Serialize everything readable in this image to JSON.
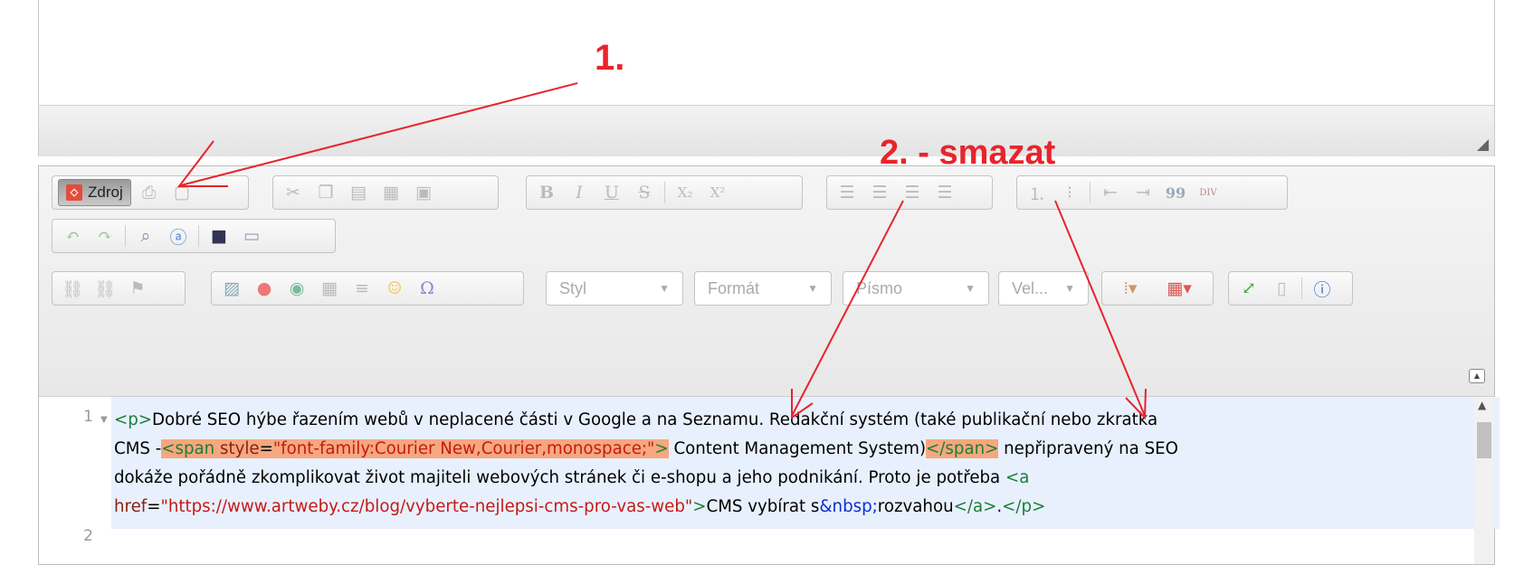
{
  "annotations": {
    "step1": "1.",
    "step2": "2. - smazat"
  },
  "toolbar": {
    "source_button": "Zdroj",
    "bold": "B",
    "italic": "I",
    "underline": "U",
    "strike": "S",
    "subscript": "X₂",
    "superscript": "X²",
    "blockquote": "99",
    "div": "DIV",
    "combos": {
      "style": "Styl",
      "format": "Formát",
      "font": "Písmo",
      "size": "Vel..."
    }
  },
  "code": {
    "line_numbers": [
      "1",
      "2"
    ],
    "line1": {
      "p_open": "<p>",
      "text1": "Dobré SEO hýbe řazením webů v neplacené části v Google a na Seznamu. Redakční systém (také publikační nebo zkratka",
      "text2_start": "CMS -",
      "span_open_start": "<span ",
      "span_attr": "style",
      "span_eq": "=",
      "span_val": "\"font-family:Courier New,Courier,monospace;\"",
      "span_open_end": ">",
      "text3": " Content Management System)",
      "span_close": "</span>",
      "text4": " nepřipravený na SEO",
      "text5": "dokáže pořádně zkomplikovat život majiteli webových stránek či e-shopu a jeho podnikání. Proto je potřeba ",
      "a_open": "<a",
      "a_attr": "href",
      "a_eq": "=",
      "a_val": "\"https://www.artweby.cz/blog/vyberte-nejlepsi-cms-pro-vas-web\"",
      "a_end": ">",
      "text6": "CMS vybírat s",
      "nbsp": "&nbsp;",
      "text7": "rozvahou",
      "a_close": "</a>",
      "dot": ".",
      "p_close": "</p>"
    }
  },
  "colors": {
    "annotation": "#e8242c",
    "highlight": "#f6a77e",
    "tag": "#1a7f37",
    "string": "#c41a16"
  }
}
